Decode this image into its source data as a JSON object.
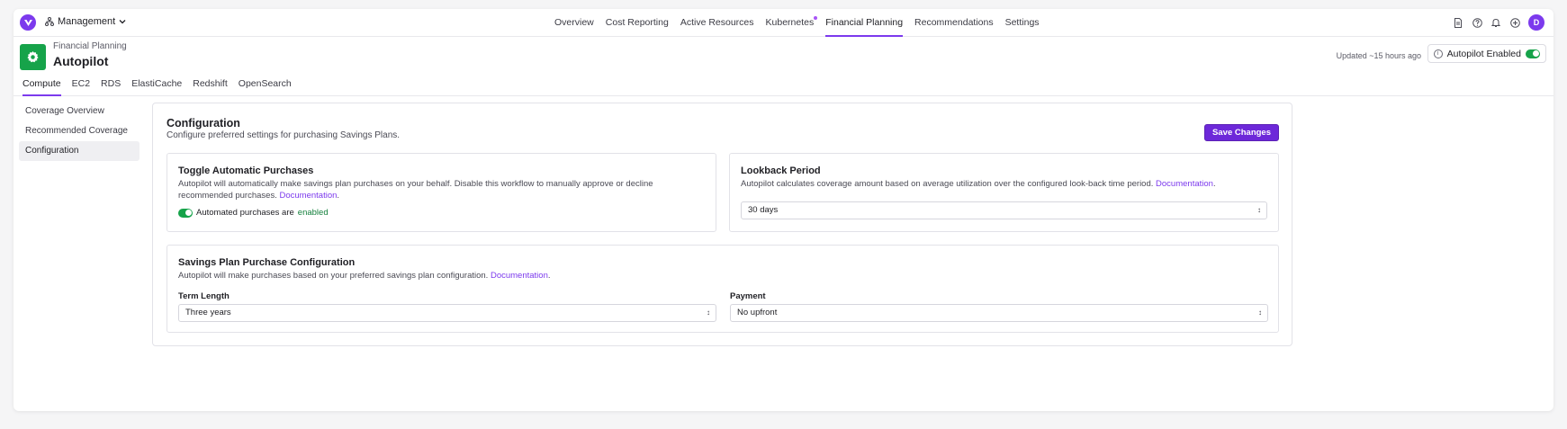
{
  "org": {
    "name": "Management"
  },
  "nav": {
    "items": [
      {
        "label": "Overview",
        "active": false
      },
      {
        "label": "Cost Reporting",
        "active": false
      },
      {
        "label": "Active Resources",
        "active": false
      },
      {
        "label": "Kubernetes",
        "active": false,
        "dot": true
      },
      {
        "label": "Financial Planning",
        "active": true
      },
      {
        "label": "Recommendations",
        "active": false
      },
      {
        "label": "Settings",
        "active": false
      }
    ],
    "icons": [
      "document-icon",
      "help-icon",
      "bell-icon",
      "plus-circle-icon"
    ],
    "avatar": "D"
  },
  "header": {
    "breadcrumb": "Financial Planning",
    "title": "Autopilot",
    "updated": "Updated ~15 hours ago",
    "autopilot_label": "Autopilot Enabled",
    "autopilot_enabled": true
  },
  "tabs": [
    {
      "label": "Compute",
      "active": true
    },
    {
      "label": "EC2",
      "active": false
    },
    {
      "label": "RDS",
      "active": false
    },
    {
      "label": "ElastiCache",
      "active": false
    },
    {
      "label": "Redshift",
      "active": false
    },
    {
      "label": "OpenSearch",
      "active": false
    }
  ],
  "sidebar": {
    "items": [
      {
        "label": "Coverage Overview",
        "active": false
      },
      {
        "label": "Recommended Coverage",
        "active": false
      },
      {
        "label": "Configuration",
        "active": true
      }
    ]
  },
  "config": {
    "title": "Configuration",
    "description": "Configure preferred settings for purchasing Savings Plans.",
    "save_label": "Save Changes",
    "toggle_card": {
      "title": "Toggle Automatic Purchases",
      "description": "Autopilot will automatically make savings plan purchases on your behalf. Disable this workflow to manually approve or decline recommended purchases.",
      "doc_link": "Documentation",
      "toggle_text": "Automated purchases are",
      "toggle_state": "enabled",
      "enabled": true
    },
    "lookback_card": {
      "title": "Lookback Period",
      "description": "Autopilot calculates coverage amount based on average utilization over the configured look-back time period.",
      "doc_link": "Documentation",
      "value": "30 days"
    },
    "savings_card": {
      "title": "Savings Plan Purchase Configuration",
      "description": "Autopilot will make purchases based on your preferred savings plan configuration.",
      "doc_link": "Documentation",
      "term_label": "Term Length",
      "term_value": "Three years",
      "payment_label": "Payment",
      "payment_value": "No upfront"
    }
  },
  "colors": {
    "accent": "#7c3aed",
    "success": "#16a34a",
    "button": "#6d28d9"
  }
}
